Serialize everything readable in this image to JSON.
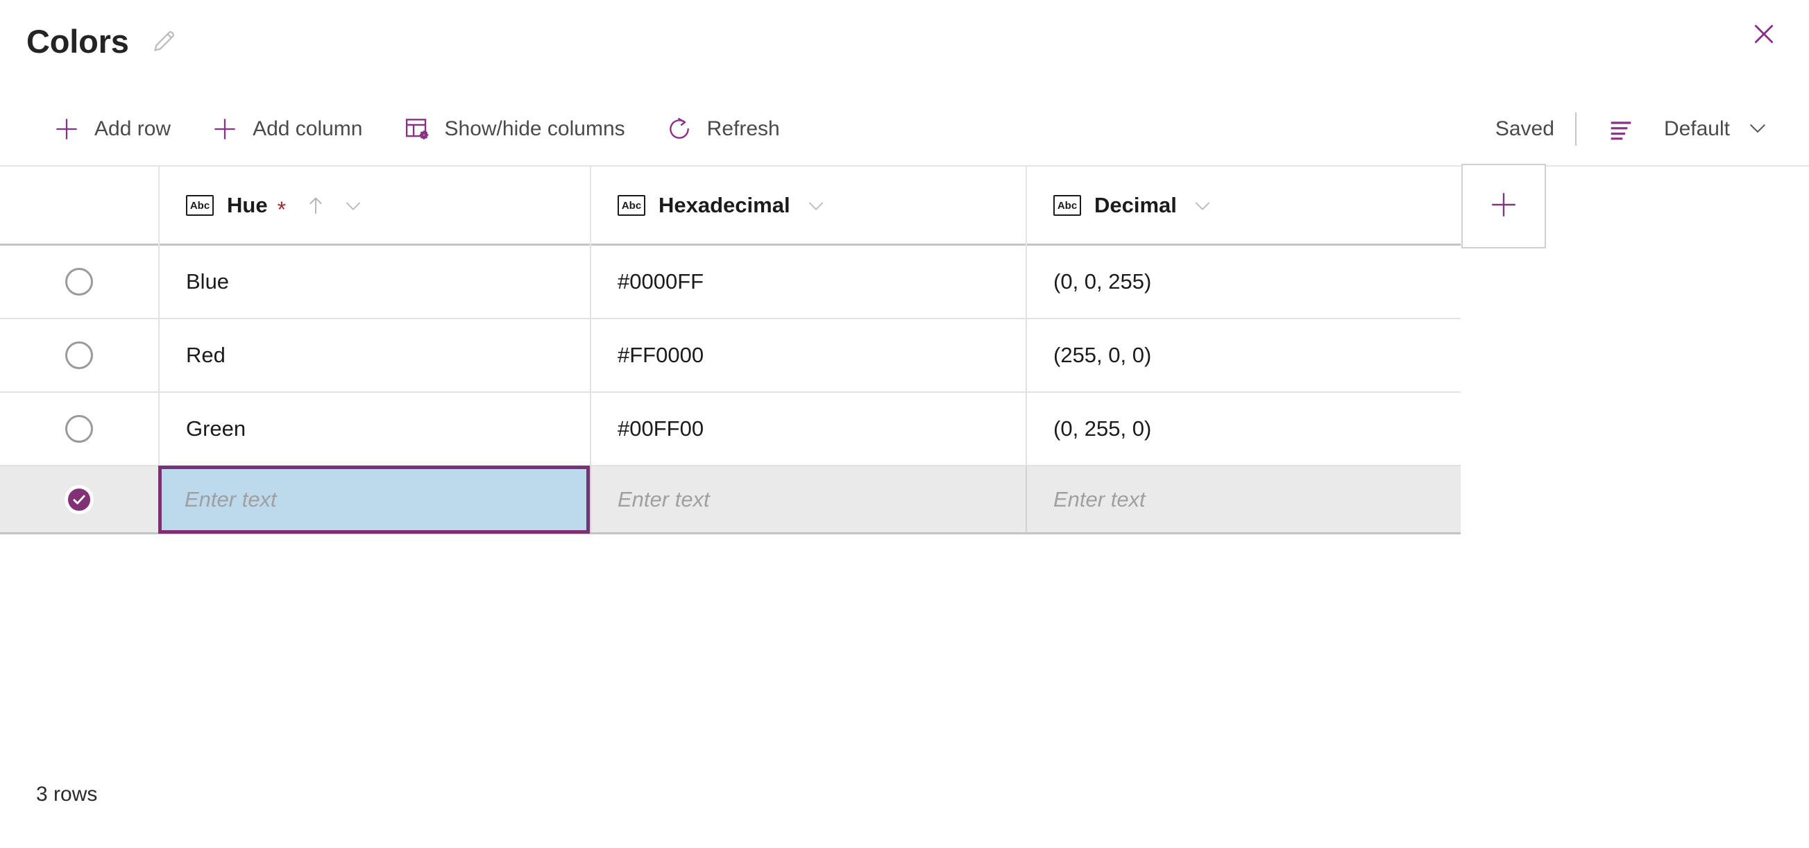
{
  "header": {
    "title": "Colors",
    "edit_icon": "pencil-icon",
    "close_icon": "close-icon"
  },
  "toolbar": {
    "add_row_label": "Add row",
    "add_column_label": "Add column",
    "show_hide_columns_label": "Show/hide columns",
    "refresh_label": "Refresh",
    "saved_label": "Saved",
    "view_label": "Default",
    "icons": {
      "add_row": "plus-icon",
      "add_column": "plus-icon",
      "show_hide_columns": "table-settings-icon",
      "refresh": "refresh-icon",
      "view": "list-view-icon",
      "view_chevron": "chevron-down-icon"
    }
  },
  "grid": {
    "type_icon_label": "Abc",
    "required_marker": "*",
    "add_column_icon": "plus-icon",
    "columns": [
      {
        "label": "Hue",
        "required": true,
        "sorted": "ascending"
      },
      {
        "label": "Hexadecimal",
        "required": false,
        "sorted": "none"
      },
      {
        "label": "Decimal",
        "required": false,
        "sorted": "none"
      }
    ],
    "rows": [
      {
        "selected": false,
        "hue": "Blue",
        "hexadecimal": "#0000FF",
        "decimal": "(0, 0, 255)"
      },
      {
        "selected": false,
        "hue": "Red",
        "hexadecimal": "#FF0000",
        "decimal": "(255, 0, 0)"
      },
      {
        "selected": false,
        "hue": "Green",
        "hexadecimal": "#00FF00",
        "decimal": "(0, 255, 0)"
      }
    ],
    "new_row": {
      "selected": true,
      "hue_placeholder": "Enter text",
      "hexadecimal_placeholder": "Enter text",
      "decimal_placeholder": "Enter text"
    }
  },
  "footer": {
    "row_count_label": "3 rows"
  },
  "colors": {
    "accent": "#8A2F86",
    "accent_dark": "#7d2f74",
    "required": "#a4262c",
    "cell_edit_bg": "#bdd9ec",
    "active_row_bg": "#ebeaea",
    "text": "#1b1b1b",
    "muted_text": "#4a4a4a",
    "placeholder": "#a0a0a0"
  }
}
